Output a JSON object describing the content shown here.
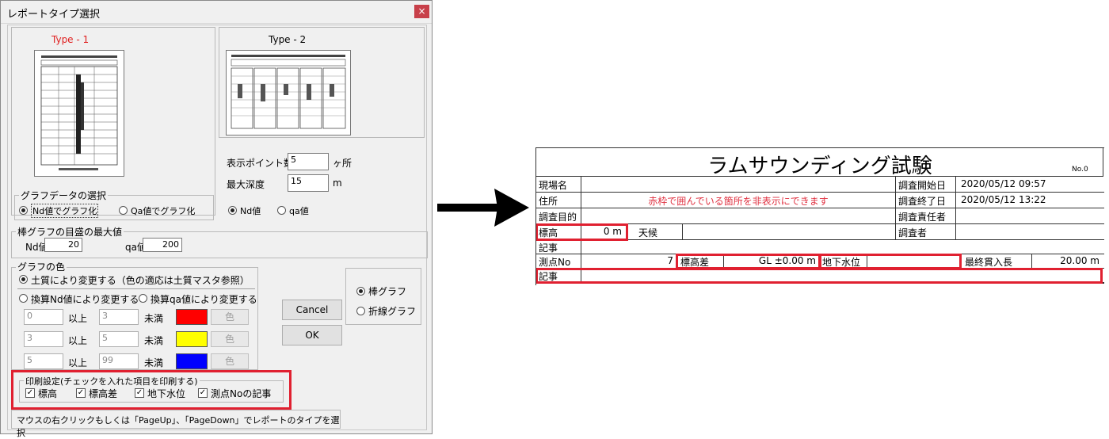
{
  "dialog": {
    "title": "レポートタイプ選択",
    "close_label": "×",
    "type1_label": "Type - 1",
    "type2_label": "Type - 2",
    "graph_data_group": "グラフデータの選択",
    "radio_nd_graph": "Nd値でグラフ化",
    "radio_qa_graph": "Qa値でグラフ化",
    "display_points_label": "表示ポイント数",
    "display_points_value": "5",
    "display_points_unit": "ヶ所",
    "max_depth_label": "最大深度",
    "max_depth_value": "15",
    "max_depth_unit": "m",
    "radio_nd_value": "Nd値",
    "radio_qa_value": "qa値",
    "bar_max_group": "棒グラフの目盛の最大値",
    "nd_label": "Nd値",
    "nd_value": "20",
    "qa_label": "qa値",
    "qa_value": "200",
    "graph_color_group": "グラフの色",
    "radio_soil": "土質により変更する（色の適応は土質マスタ参照）",
    "radio_nd_change": "換算Nd値により変更する",
    "radio_qa_change": "換算qa値により変更する",
    "color_rows": [
      {
        "from": "0",
        "from_unit": "以上",
        "to": "3",
        "to_unit": "未満",
        "color": "#ff0000",
        "button": "色"
      },
      {
        "from": "3",
        "from_unit": "以上",
        "to": "5",
        "to_unit": "未満",
        "color": "#ffff00",
        "button": "色"
      },
      {
        "from": "5",
        "from_unit": "以上",
        "to": "99",
        "to_unit": "未満",
        "color": "#0000ff",
        "button": "色"
      }
    ],
    "radio_bar": "棒グラフ",
    "radio_line": "折線グラフ",
    "cancel_label": "Cancel",
    "ok_label": "OK",
    "print_group": "印刷設定(チェックを入れた項目を印刷する)",
    "print_items": [
      "標高",
      "標高差",
      "地下水位",
      "測点Noの記事"
    ],
    "status_text": "マウスの右クリックもしくは「PageUp」、「PageDown」でレポートのタイプを選択"
  },
  "report": {
    "title": "ラムサウンディング試験",
    "no_label": "No.0",
    "site_name_label": "現場名",
    "address_label": "住所",
    "note": "赤枠で囲んでいる箇所を非表示にできます",
    "purpose_label": "調査目的",
    "elevation_label": "標高",
    "elevation_value": "0 m",
    "weather_label": "天候",
    "remarks_label": "記事",
    "start_date_label": "調査開始日",
    "start_date_value": "2020/05/12 09:57",
    "end_date_label": "調査終了日",
    "end_date_value": "2020/05/12 13:22",
    "manager_label": "調査責任者",
    "surveyor_label": "調査者",
    "point_no_label": "測点No",
    "point_no_value": "7",
    "elev_diff_label": "標高差",
    "elev_diff_value": "GL ±0.00 m",
    "groundwater_label": "地下水位",
    "final_length_label": "最終貫入長",
    "final_length_value": "20.00 m",
    "remarks2_label": "記事"
  },
  "colors": {
    "highlight": "#e02030",
    "note_text": "#e03040"
  }
}
